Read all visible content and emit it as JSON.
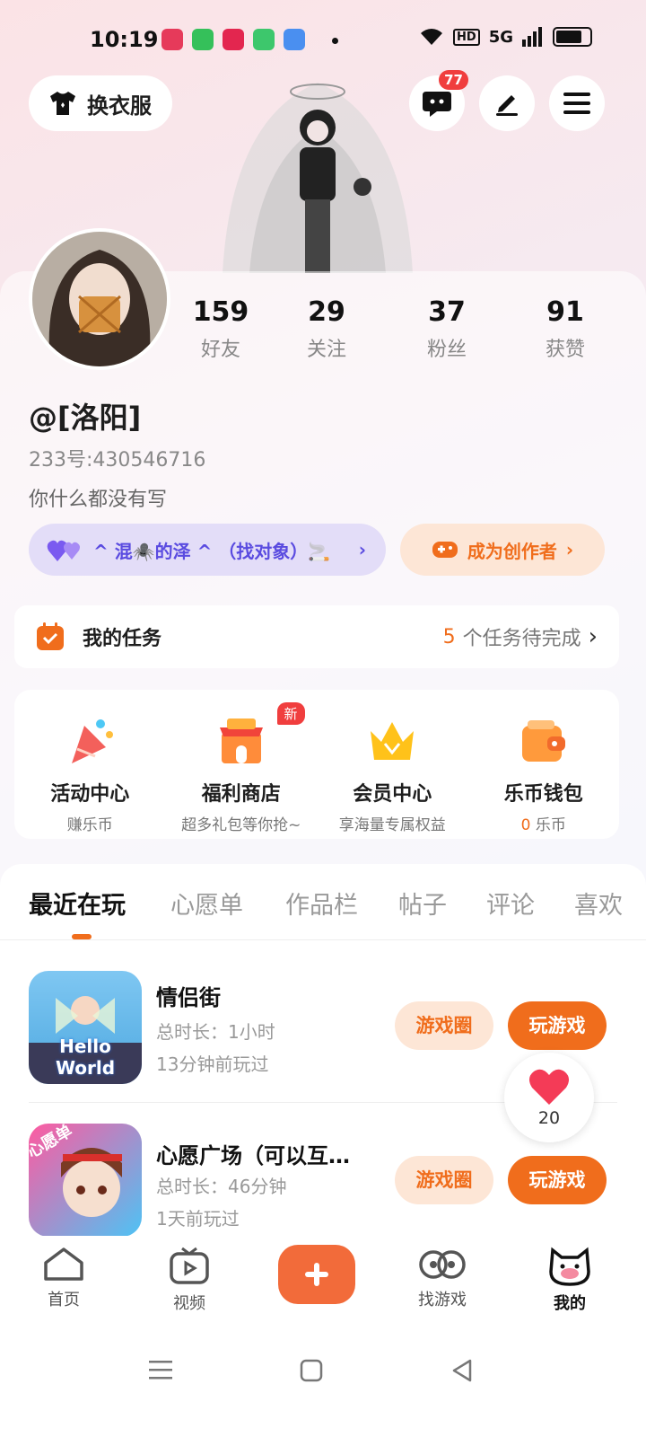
{
  "status": {
    "time": "10:19",
    "app_icons": [
      "#e63a5a",
      "#35c05a",
      "#e3264f",
      "#3dc76c",
      "#4a8ff0"
    ],
    "net1": "HD",
    "net2": "5G"
  },
  "header": {
    "wardrobe_label": "换衣服",
    "message_badge": "77"
  },
  "profile": {
    "stats": [
      {
        "num": "159",
        "label": "好友"
      },
      {
        "num": "29",
        "label": "关注"
      },
      {
        "num": "37",
        "label": "粉丝"
      },
      {
        "num": "91",
        "label": "获赞"
      }
    ],
    "name": "@[洛阳]",
    "uid": "233号:430546716",
    "bio": "你什么都没有写",
    "couple_text": "^ 混🕷️的泽 ^ （找对象）🚬",
    "creator_label": "成为创作者"
  },
  "tasks": {
    "title": "我的任务",
    "count": "5",
    "suffix": "个任务待完成"
  },
  "grid": [
    {
      "title": "活动中心",
      "sub": "赚乐币",
      "icon": "party-icon"
    },
    {
      "title": "福利商店",
      "sub": "超多礼包等你抢~",
      "icon": "shop-icon",
      "badge": "新"
    },
    {
      "title": "会员中心",
      "sub": "享海量专属权益",
      "icon": "crown-icon"
    },
    {
      "title": "乐币钱包",
      "sub_num": "0",
      "sub": "乐币",
      "icon": "wallet-icon"
    }
  ],
  "tabs": [
    "最近在玩",
    "心愿单",
    "作品栏",
    "帖子",
    "评论",
    "喜欢"
  ],
  "games": [
    {
      "title": "情侣街",
      "duration": "总时长：1小时",
      "last": "13分钟前玩过",
      "circle": "游戏圈",
      "play": "玩游戏",
      "thumb_text": "Hello World"
    },
    {
      "title": "心愿广场（可以互…",
      "duration": "总时长：46分钟",
      "last": "1天前玩过",
      "circle": "游戏圈",
      "play": "玩游戏",
      "thumb_text": "心愿单"
    }
  ],
  "like_count": "20",
  "nav": [
    "首页",
    "视频",
    "找游戏",
    "我的"
  ],
  "colors": {
    "accent": "#f06d1c",
    "purple": "#5a4be0"
  }
}
